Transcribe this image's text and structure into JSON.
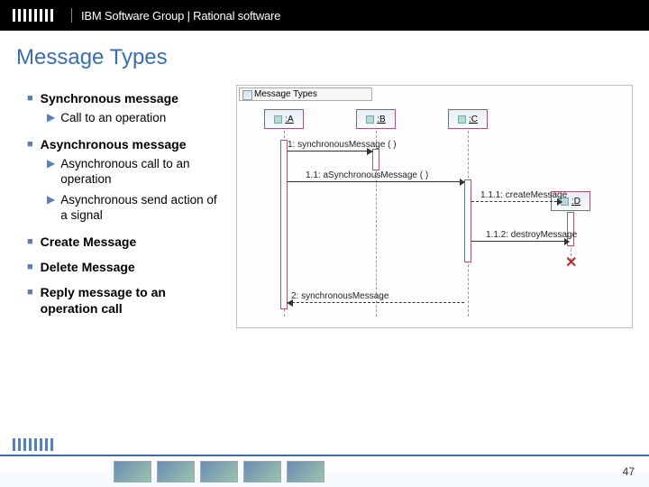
{
  "header": {
    "group_text": "IBM Software Group | Rational software"
  },
  "title": "Message Types",
  "bullets": {
    "sync": {
      "heading": "Synchronous message",
      "sub1": "Call to an operation"
    },
    "async": {
      "heading": "Asynchronous message",
      "sub1": "Asynchronous call to an operation",
      "sub2": "Asynchronous send action of a signal"
    },
    "create": {
      "heading": "Create Message"
    },
    "delete": {
      "heading": "Delete Message"
    },
    "reply": {
      "heading": "Reply message to an operation call"
    }
  },
  "diagram": {
    "frame_title": "Message Types",
    "lifelines": {
      "A": ":A",
      "B": ":B",
      "C": ":C",
      "D": ":D"
    },
    "messages": {
      "m1": "1: synchronousMessage ( )",
      "m2": "1.1: aSynchronousMessage ( )",
      "m3": "1.1.1: createMessage",
      "m4": "1.1.2: destroyMessage",
      "m5": "2: synchronousMessage"
    }
  },
  "footer": {
    "page": "47"
  }
}
